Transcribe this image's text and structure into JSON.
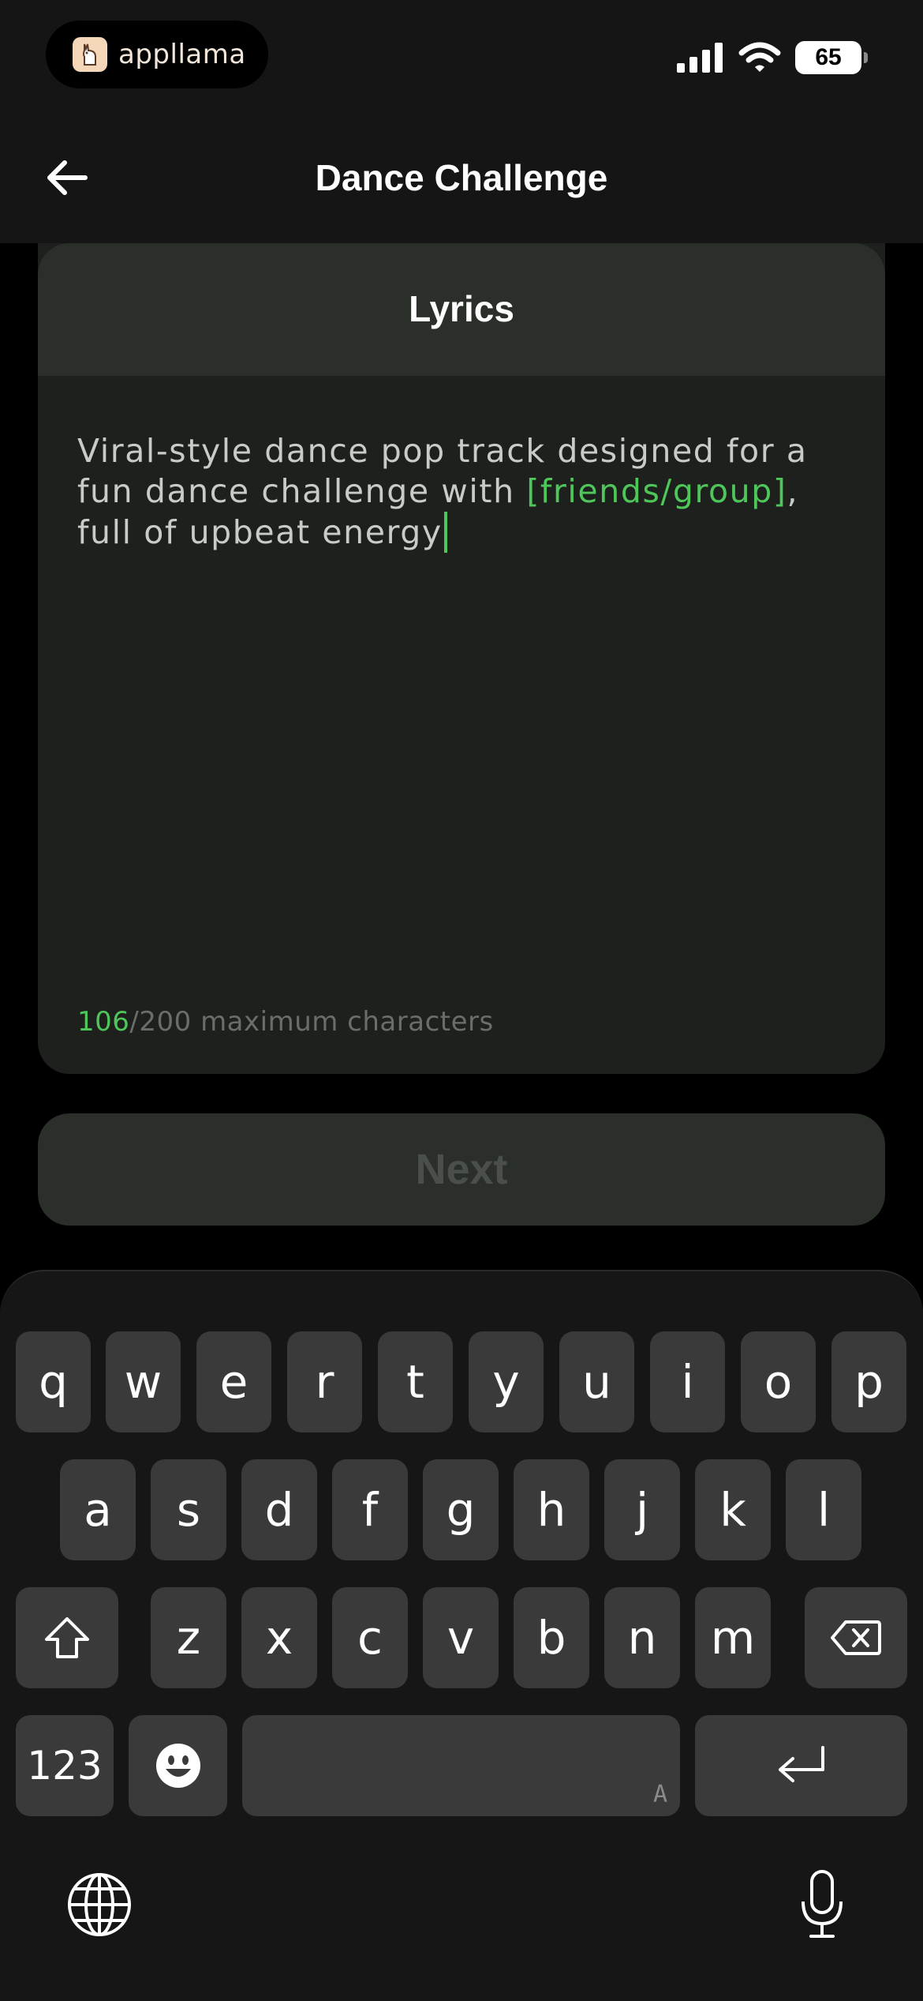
{
  "status_bar": {
    "brand_name": "appllama",
    "battery_level": "65",
    "icons": [
      "cellular-signal-icon",
      "wifi-icon",
      "battery-icon"
    ]
  },
  "header": {
    "back_icon": "arrow-left-icon",
    "title": "Dance Challenge"
  },
  "lyrics_card": {
    "title": "Lyrics",
    "text_before": "Viral-style dance pop track designed for a fun dance challenge with ",
    "placeholder_token": "[friends/group]",
    "text_after": ", full of upbeat energy",
    "char_count": "106",
    "char_limit_text": "/200 maximum characters"
  },
  "actions": {
    "next_label": "Next",
    "next_enabled": false
  },
  "keyboard": {
    "row1": [
      "q",
      "w",
      "e",
      "r",
      "t",
      "y",
      "u",
      "i",
      "o",
      "p"
    ],
    "row2": [
      "a",
      "s",
      "d",
      "f",
      "g",
      "h",
      "j",
      "k",
      "l"
    ],
    "row3": [
      "z",
      "x",
      "c",
      "v",
      "b",
      "n",
      "m"
    ],
    "numbers_label": "123",
    "space_hint": "A"
  },
  "colors": {
    "accent": "#4fc65a",
    "card_bg": "#1d201d",
    "card_header_bg": "#2a2f2a",
    "key_bg": "#3a3a3a"
  }
}
